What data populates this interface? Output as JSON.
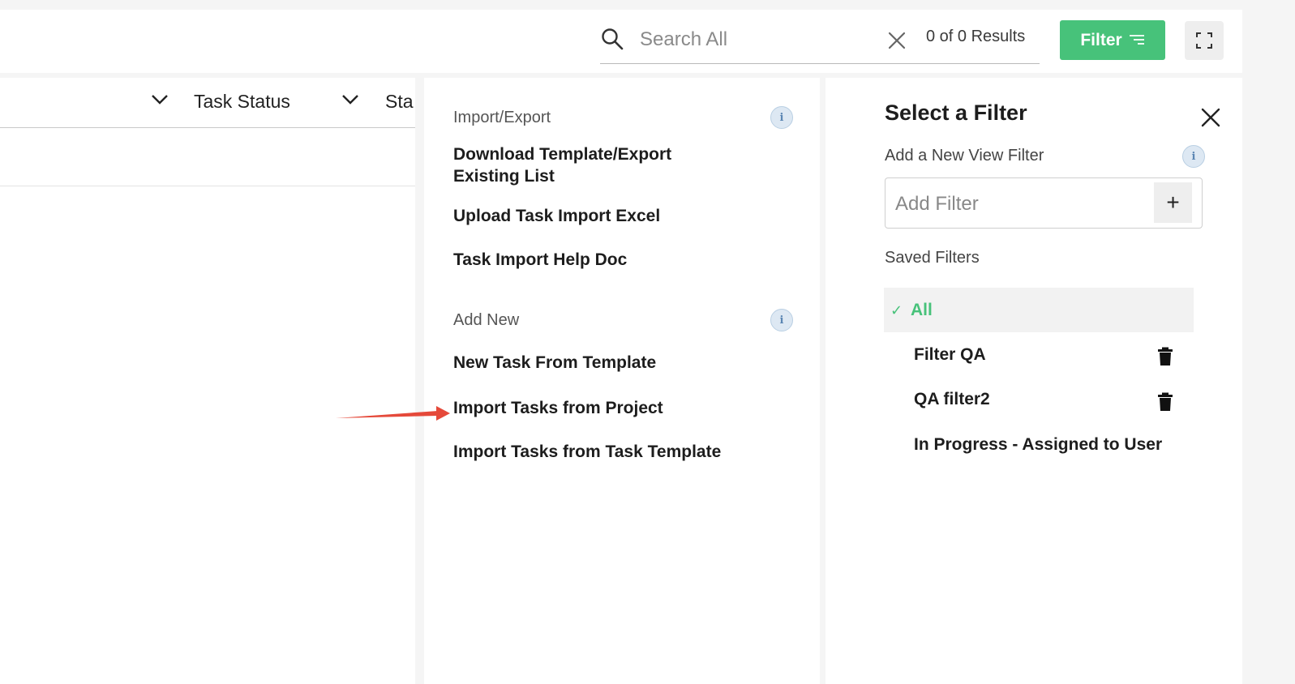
{
  "header": {
    "search_placeholder": "Search All",
    "results_text": "0 of 0 Results",
    "filter_button_label": "Filter",
    "icons": {
      "search": "search-icon",
      "clear": "close-icon",
      "filter": "filter-lines-icon",
      "expand": "expand-icon"
    }
  },
  "table": {
    "columns": [
      {
        "label": "Task Status"
      },
      {
        "label": "Sta"
      }
    ]
  },
  "menu": {
    "import_export": {
      "title": "Import/Export",
      "items": [
        {
          "label": "Download Template/Export Existing List"
        },
        {
          "label": "Upload Task Import Excel"
        },
        {
          "label": "Task Import Help Doc"
        }
      ]
    },
    "add_new": {
      "title": "Add New",
      "items": [
        {
          "label": "New Task From Template"
        },
        {
          "label": "Import Tasks from Project"
        },
        {
          "label": "Import Tasks from Task Template"
        }
      ]
    },
    "info_glyph": "i"
  },
  "filter_panel": {
    "title": "Select a Filter",
    "add_view_filter_label": "Add a New View Filter",
    "add_filter_placeholder": "Add Filter",
    "add_button_label": "+",
    "saved_filters_label": "Saved Filters",
    "saved_filters": [
      {
        "label": "All",
        "selected": true,
        "check": "✓"
      },
      {
        "label": "Filter QA",
        "deletable": true
      },
      {
        "label": "QA filter2",
        "deletable": true
      },
      {
        "label": "In Progress - Assigned to User",
        "deletable": false
      }
    ]
  },
  "colors": {
    "accent_green": "#47c27a",
    "annotation_arrow": "#e5493a",
    "info_blue": "#5b86b3"
  }
}
